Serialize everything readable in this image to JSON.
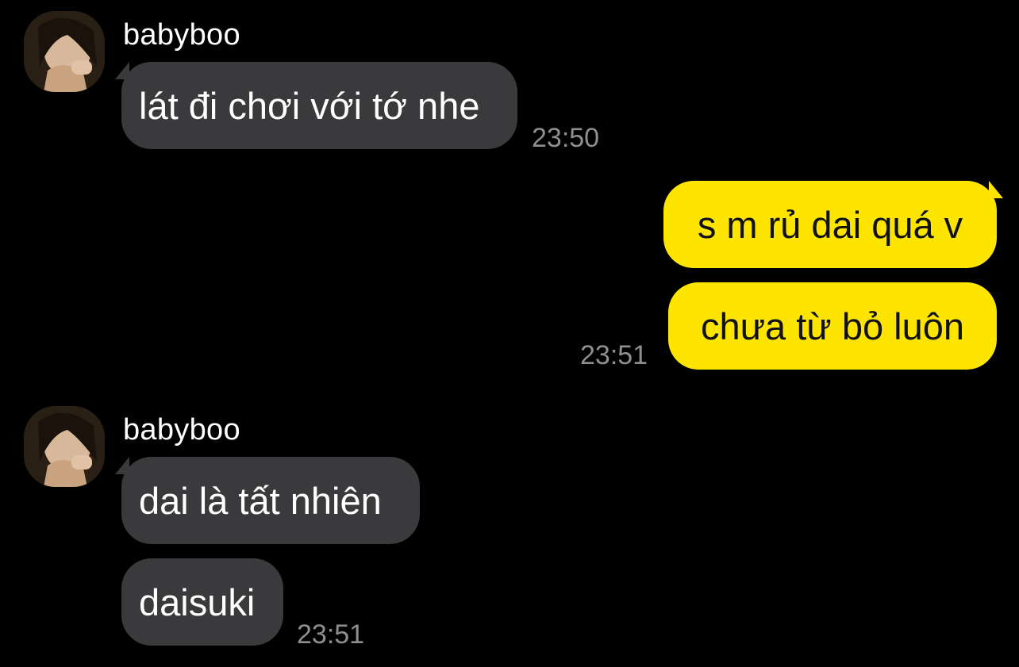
{
  "colors": {
    "background": "#000000",
    "incoming_bubble": "#3a3a3c",
    "outgoing_bubble": "#fee500",
    "timestamp": "#8e8e93"
  },
  "groups": [
    {
      "sender": "babyboo",
      "messages": [
        "lát đi chơi với tớ nhe"
      ],
      "time": "23:50"
    },
    {
      "sender": "",
      "messages": [
        "s m rủ dai quá v",
        "chưa từ bỏ luôn"
      ],
      "time": "23:51"
    },
    {
      "sender": "babyboo",
      "messages": [
        "dai là tất nhiên",
        "daisuki"
      ],
      "time": "23:51"
    }
  ]
}
